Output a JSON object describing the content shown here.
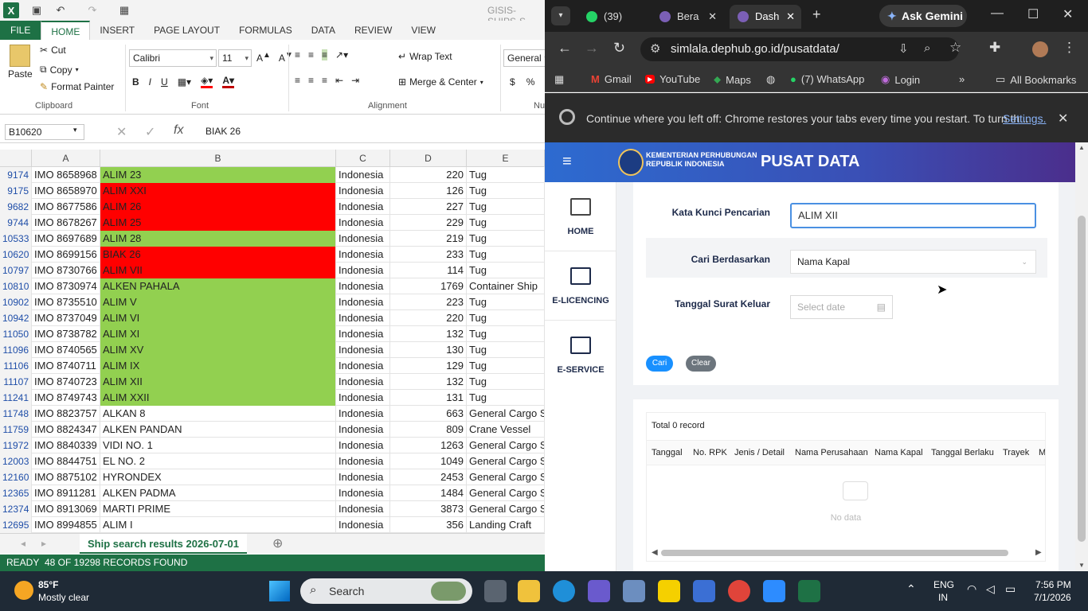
{
  "excel": {
    "title": "GISIS-SHIPS-S",
    "tabs": [
      "FILE",
      "HOME",
      "INSERT",
      "PAGE LAYOUT",
      "FORMULAS",
      "DATA",
      "REVIEW",
      "VIEW"
    ],
    "clipboard": {
      "paste": "Paste",
      "cut": "Cut",
      "copy": "Copy",
      "format_painter": "Format Painter",
      "label": "Clipboard"
    },
    "font": {
      "name": "Calibri",
      "size": "11",
      "label": "Font",
      "bold": "B",
      "italic": "I",
      "underline": "U"
    },
    "alignment": {
      "wrap": "Wrap Text",
      "merge": "Merge & Center",
      "label": "Alignment"
    },
    "number": {
      "format": "General",
      "currency": "$",
      "percent": "%",
      "label": "Nu"
    },
    "name_box": "B10620",
    "formula": "BIAK 26",
    "fx": "fx",
    "columns": [
      "A",
      "B",
      "C",
      "D",
      "E"
    ],
    "rows": [
      {
        "n": "9174",
        "a": "IMO 8658968",
        "b": "ALIM 23",
        "c": "Indonesia",
        "d": "220",
        "e": "Tug",
        "fill": "green"
      },
      {
        "n": "9175",
        "a": "IMO 8658970",
        "b": "ALIM XXI",
        "c": "Indonesia",
        "d": "126",
        "e": "Tug",
        "fill": "red"
      },
      {
        "n": "9682",
        "a": "IMO 8677586",
        "b": "ALIM 26",
        "c": "Indonesia",
        "d": "227",
        "e": "Tug",
        "fill": "red"
      },
      {
        "n": "9744",
        "a": "IMO 8678267",
        "b": "ALIM 25",
        "c": "Indonesia",
        "d": "229",
        "e": "Tug",
        "fill": "red"
      },
      {
        "n": "10533",
        "a": "IMO 8697689",
        "b": "ALIM 28",
        "c": "Indonesia",
        "d": "219",
        "e": "Tug",
        "fill": "green"
      },
      {
        "n": "10620",
        "a": "IMO 8699156",
        "b": "BIAK 26",
        "c": "Indonesia",
        "d": "233",
        "e": "Tug",
        "fill": "red"
      },
      {
        "n": "10797",
        "a": "IMO 8730766",
        "b": "ALIM VII",
        "c": "Indonesia",
        "d": "114",
        "e": "Tug",
        "fill": "red"
      },
      {
        "n": "10810",
        "a": "IMO 8730974",
        "b": "ALKEN PAHALA",
        "c": "Indonesia",
        "d": "1769",
        "e": "Container Ship",
        "fill": "green"
      },
      {
        "n": "10902",
        "a": "IMO 8735510",
        "b": "ALIM V",
        "c": "Indonesia",
        "d": "223",
        "e": "Tug",
        "fill": "green"
      },
      {
        "n": "10942",
        "a": "IMO 8737049",
        "b": "ALIM VI",
        "c": "Indonesia",
        "d": "220",
        "e": "Tug",
        "fill": "green"
      },
      {
        "n": "11050",
        "a": "IMO 8738782",
        "b": "ALIM XI",
        "c": "Indonesia",
        "d": "132",
        "e": "Tug",
        "fill": "green"
      },
      {
        "n": "11096",
        "a": "IMO 8740565",
        "b": "ALIM XV",
        "c": "Indonesia",
        "d": "130",
        "e": "Tug",
        "fill": "green"
      },
      {
        "n": "11106",
        "a": "IMO 8740711",
        "b": "ALIM IX",
        "c": "Indonesia",
        "d": "129",
        "e": "Tug",
        "fill": "green"
      },
      {
        "n": "11107",
        "a": "IMO 8740723",
        "b": "ALIM XII",
        "c": "Indonesia",
        "d": "132",
        "e": "Tug",
        "fill": "green"
      },
      {
        "n": "11241",
        "a": "IMO 8749743",
        "b": "ALIM XXII",
        "c": "Indonesia",
        "d": "131",
        "e": "Tug",
        "fill": "green"
      },
      {
        "n": "11748",
        "a": "IMO 8823757",
        "b": "ALKAN 8",
        "c": "Indonesia",
        "d": "663",
        "e": "General Cargo S",
        "fill": "none"
      },
      {
        "n": "11759",
        "a": "IMO 8824347",
        "b": "ALKEN PANDAN",
        "c": "Indonesia",
        "d": "809",
        "e": "Crane Vessel",
        "fill": "none"
      },
      {
        "n": "11972",
        "a": "IMO 8840339",
        "b": "VIDI NO. 1",
        "c": "Indonesia",
        "d": "1263",
        "e": "General Cargo S",
        "fill": "none"
      },
      {
        "n": "12003",
        "a": "IMO 8844751",
        "b": "EL NO. 2",
        "c": "Indonesia",
        "d": "1049",
        "e": "General Cargo S",
        "fill": "none"
      },
      {
        "n": "12160",
        "a": "IMO 8875102",
        "b": "HYRONDEX",
        "c": "Indonesia",
        "d": "2453",
        "e": "General Cargo S",
        "fill": "none"
      },
      {
        "n": "12365",
        "a": "IMO 8911281",
        "b": "ALKEN PADMA",
        "c": "Indonesia",
        "d": "1484",
        "e": "General Cargo S",
        "fill": "none"
      },
      {
        "n": "12374",
        "a": "IMO 8913069",
        "b": "MARTI PRIME",
        "c": "Indonesia",
        "d": "3873",
        "e": "General Cargo S",
        "fill": "none"
      },
      {
        "n": "12695",
        "a": "IMO 8994855",
        "b": "ALIM I",
        "c": "Indonesia",
        "d": "356",
        "e": "Landing Craft",
        "fill": "none"
      }
    ],
    "sheet_tab": "Ship search results 2026-07-01",
    "status_ready": "READY",
    "status_records": "48 OF 19298 RECORDS FOUND",
    "colors": {
      "green": "#92d050",
      "red": "#ff0000",
      "brand": "#1e7145"
    }
  },
  "chrome": {
    "tabs": [
      {
        "label": "(39)",
        "icon": "whatsapp-icon"
      },
      {
        "label": "Bera",
        "icon": "globe-icon"
      },
      {
        "label": "Dash",
        "icon": "globe-icon",
        "active": true
      }
    ],
    "gemini": "Ask Gemini",
    "url": "simlala.dephub.go.id/pusatdata/",
    "bookmarks": [
      "Gmail",
      "YouTube",
      "Maps",
      "(7) WhatsApp",
      "Login"
    ],
    "all_bookmarks": "All Bookmarks",
    "info_text": "Continue where you left off: Chrome restores your tabs every time you restart. To turn th...",
    "info_link": "Settings."
  },
  "site": {
    "org_line1": "KEMENTERIAN PERHUBUNGAN",
    "org_line2": "REPUBLIK INDONESIA",
    "title": "PUSAT DATA",
    "nav": [
      "HOME",
      "E-LICENCING",
      "E-SERVICE"
    ],
    "form": {
      "kata_label": "Kata Kunci Pencarian",
      "kata_value": "ALIM XII",
      "cari_label": "Cari Berdasarkan",
      "cari_value": "Nama Kapal",
      "tanggal_label": "Tanggal Surat Keluar",
      "tanggal_placeholder": "Select date",
      "btn_cari": "Cari",
      "btn_clear": "Clear"
    },
    "results": {
      "total": "Total 0 record",
      "columns": [
        "Tanggal",
        "No. RPK",
        "Jenis / Detail",
        "Nama Perusahaan",
        "Nama Kapal",
        "Tanggal Berlaku",
        "Trayek",
        "M"
      ],
      "empty": "No data"
    }
  },
  "taskbar": {
    "weather_temp": "85°F",
    "weather_desc": "Mostly clear",
    "search": "Search",
    "lang1": "ENG",
    "lang2": "IN",
    "time": "7:56 PM",
    "date": "7/1/2026"
  }
}
